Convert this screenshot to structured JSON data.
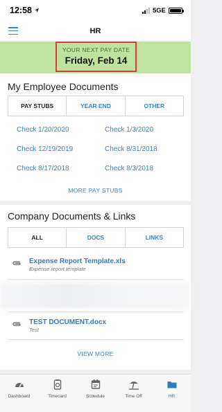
{
  "status_bar": {
    "time": "12:58",
    "network": "5GE"
  },
  "header": {
    "title": "HR"
  },
  "pay_banner": {
    "label": "YOUR NEXT PAY DATE",
    "date": "Friday, Feb 14"
  },
  "documents": {
    "title": "My Employee Documents",
    "tabs": [
      "PAY STUBS",
      "YEAR END",
      "OTHER"
    ],
    "checks": [
      "Check 1/20/2020",
      "Check 1/3/2020",
      "Check 12/19/2019",
      "Check 8/31/2018",
      "Check 8/17/2018",
      "Check 8/3/2018"
    ],
    "more_label": "MORE PAY STUBS"
  },
  "links": {
    "title": "Company Documents & Links",
    "tabs": [
      "ALL",
      "DOCS",
      "LINKS"
    ],
    "items": [
      {
        "name": "Expense Report Template.xls",
        "subtitle": "Expense report template"
      },
      {
        "name": "TEST DOCUMENT.docx",
        "subtitle": "Test"
      }
    ],
    "more_label": "VIEW MORE"
  },
  "bottom_nav": {
    "items": [
      {
        "label": "Dashboard",
        "icon": "gauge-icon"
      },
      {
        "label": "Timecard",
        "icon": "timecard-icon"
      },
      {
        "label": "Schedule",
        "icon": "calendar-icon"
      },
      {
        "label": "Time Off",
        "icon": "beach-icon"
      },
      {
        "label": "HR",
        "icon": "folder-icon"
      }
    ],
    "active": "HR"
  },
  "colors": {
    "accent": "#3a86c4",
    "banner": "#bee39c",
    "highlight_border": "#e0383a"
  }
}
